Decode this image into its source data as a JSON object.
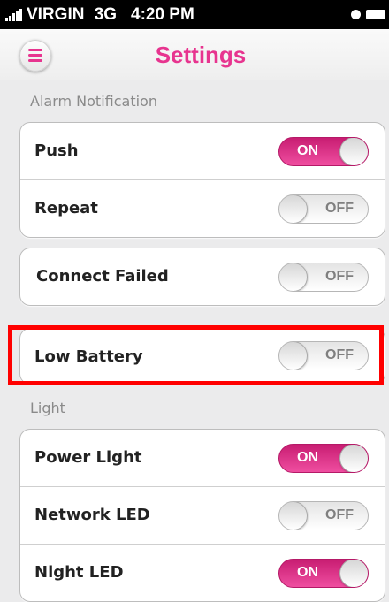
{
  "status_bar": {
    "carrier": "VIRGIN",
    "network": "3G",
    "time": "4:20 PM"
  },
  "nav": {
    "title": "Settings",
    "menu_icon": "list-icon"
  },
  "sections": {
    "alarm": {
      "header": "Alarm Notification"
    },
    "light": {
      "header": "Light"
    }
  },
  "rows": {
    "push": {
      "label": "Push",
      "state": "ON"
    },
    "repeat": {
      "label": "Repeat",
      "state": "OFF"
    },
    "connect_failed": {
      "label": "Connect  Failed",
      "state": "OFF"
    },
    "low_battery": {
      "label": "Low Battery",
      "state": "OFF"
    },
    "power_light": {
      "label": "Power Light",
      "state": "ON"
    },
    "network_led": {
      "label": "Network LED",
      "state": "OFF"
    },
    "night_led": {
      "label": "Night LED",
      "state": "ON"
    }
  },
  "colors": {
    "accent": "#e7348f",
    "highlight": "#ff0000",
    "background": "#ebebec"
  }
}
